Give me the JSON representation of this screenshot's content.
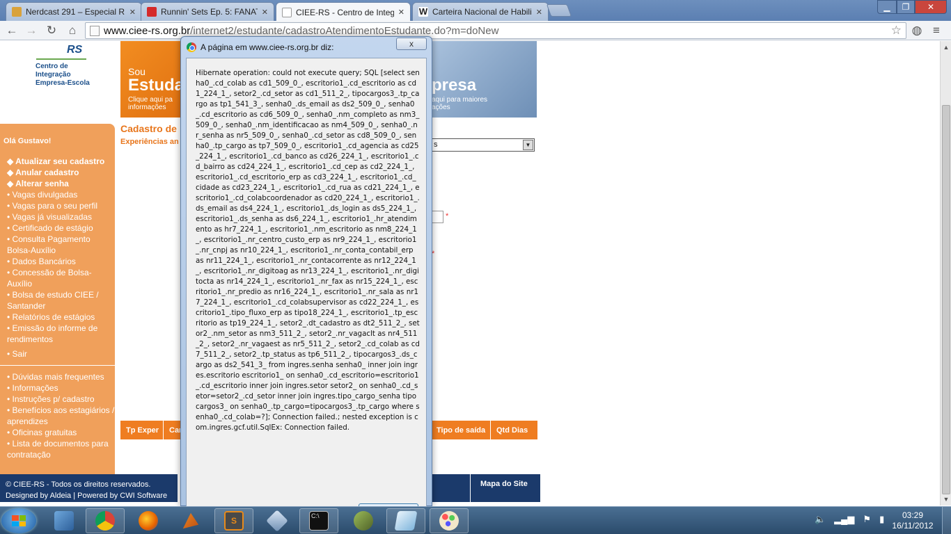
{
  "browser": {
    "tabs": [
      {
        "title": "Nerdcast 291 – Especial RPG",
        "active": false
      },
      {
        "title": "Runnin' Sets Ep. 5: FANAT",
        "active": false
      },
      {
        "title": "CIEE-RS - Centro de Integ",
        "active": true
      },
      {
        "title": "Carteira Nacional de Habili",
        "active": false
      }
    ],
    "url_host": "www.ciee-rs.org.br",
    "url_path": "/internet2/estudante/cadastroAtendimentoEstudante.do?m=doNew"
  },
  "page": {
    "logo": {
      "rs": "RS",
      "name_lines": [
        "Centro de",
        "Integração",
        "Empresa-Escola"
      ]
    },
    "banner_left": {
      "sou": "Sou",
      "big": "Estuda",
      "small_lines": [
        "Clique aqui pa",
        "informações"
      ]
    },
    "banner_right": {
      "big": "presa",
      "small_lines": [
        "aqui para maiores",
        "ações"
      ]
    },
    "title": "Cadastro de",
    "subtitle": "Experiências an",
    "select_value": "s",
    "required_mark": "*",
    "sidebar": {
      "greeting": "Olá Gustavo!",
      "bold_items": [
        "Atualizar seu cadastro",
        "Anular cadastro",
        "Alterar senha"
      ],
      "items": [
        "Vagas divulgadas",
        "Vagas para o seu perfil",
        "Vagas já visualizadas",
        "Certificado de estágio",
        "Consulta Pagamento Bolsa-Auxílio",
        "Dados Bancários",
        "Concessão de Bolsa-Auxílio",
        "Bolsa de estudo CIEE / Santander",
        "Relatórios de estágios",
        "Emissão do informe de rendimentos"
      ],
      "exit": "Sair",
      "help_items": [
        "Dúvidas mais frequentes",
        "Informações",
        "Instruções p/ cadastro",
        "Benefícios aos estagiários / aprendizes",
        "Oficinas gratuitas",
        "Lista de documentos para contratação"
      ]
    },
    "table_headers": [
      "Tp Exper",
      "Car",
      "Tipo de saída",
      "Qtd Dias"
    ],
    "footer": {
      "line1": "© CIEE-RS - Todos os direitos reservados.",
      "line2": "Designed by Aldeia | Powered by CWI Software",
      "site_map": "Mapa do Site"
    }
  },
  "dialog": {
    "title": "A página em www.ciee-rs.org.br diz:",
    "close_label": "x",
    "message": "Hibernate operation: could not execute query; SQL [select senha0_.cd_colab as cd1_509_0_, escritorio1_.cd_escritorio as cd1_224_1_, setor2_.cd_setor as cd1_511_2_, tipocargos3_.tp_cargo as tp1_541_3_, senha0_.ds_email as ds2_509_0_, senha0_.cd_escritorio as cd6_509_0_, senha0_.nm_completo as nm3_509_0_, senha0_.nm_identificacao as nm4_509_0_, senha0_.nr_senha as nr5_509_0_, senha0_.cd_setor as cd8_509_0_, senha0_.tp_cargo as tp7_509_0_, escritorio1_.cd_agencia as cd25_224_1_, escritorio1_.cd_banco as cd26_224_1_, escritorio1_.cd_bairro as cd24_224_1_, escritorio1_.cd_cep as cd2_224_1_, escritorio1_.cd_escritorio_erp as cd3_224_1_, escritorio1_.cd_cidade as cd23_224_1_, escritorio1_.cd_rua as cd21_224_1_, escritorio1_.cd_colabcoordenador as cd20_224_1_, escritorio1_.ds_email as ds4_224_1_, escritorio1_.ds_login as ds5_224_1_, escritorio1_.ds_senha as ds6_224_1_, escritorio1_.hr_atendimento as hr7_224_1_, escritorio1_.nm_escritorio as nm8_224_1_, escritorio1_.nr_centro_custo_erp as nr9_224_1_, escritorio1_.nr_cnpj as nr10_224_1_, escritorio1_.nr_conta_contabil_erp as nr11_224_1_, escritorio1_.nr_contacorrente as nr12_224_1_, escritorio1_.nr_digitoag as nr13_224_1_, escritorio1_.nr_digitocta as nr14_224_1_, escritorio1_.nr_fax as nr15_224_1_, escritorio1_.nr_predio as nr16_224_1_, escritorio1_.nr_sala as nr17_224_1_, escritorio1_.cd_colabsupervisor as cd22_224_1_, escritorio1_.tipo_fluxo_erp as tipo18_224_1_, escritorio1_.tp_escritorio as tp19_224_1_, setor2_.dt_cadastro as dt2_511_2_, setor2_.nm_setor as nm3_511_2_, setor2_.nr_vagaclt as nr4_511_2_, setor2_.nr_vagaest as nr5_511_2_, setor2_.cd_colab as cd7_511_2_, setor2_.tp_status as tp6_511_2_, tipocargos3_.ds_cargo as ds2_541_3_ from ingres.senha senha0_ inner join ingres.escritorio escritorio1_ on senha0_.cd_escritorio=escritorio1_.cd_escritorio inner join ingres.setor setor2_ on senha0_.cd_setor=setor2_.cd_setor inner join ingres.tipo_cargo_senha tipocargos3_ on senha0_.tp_cargo=tipocargos3_.tp_cargo where senha0_.cd_colab=?]; Connection failed.; nested exception is com.ingres.gcf.util.SqlEx: Connection failed."
  },
  "taskbar": {
    "time": "03:29",
    "date": "16/11/2012"
  }
}
